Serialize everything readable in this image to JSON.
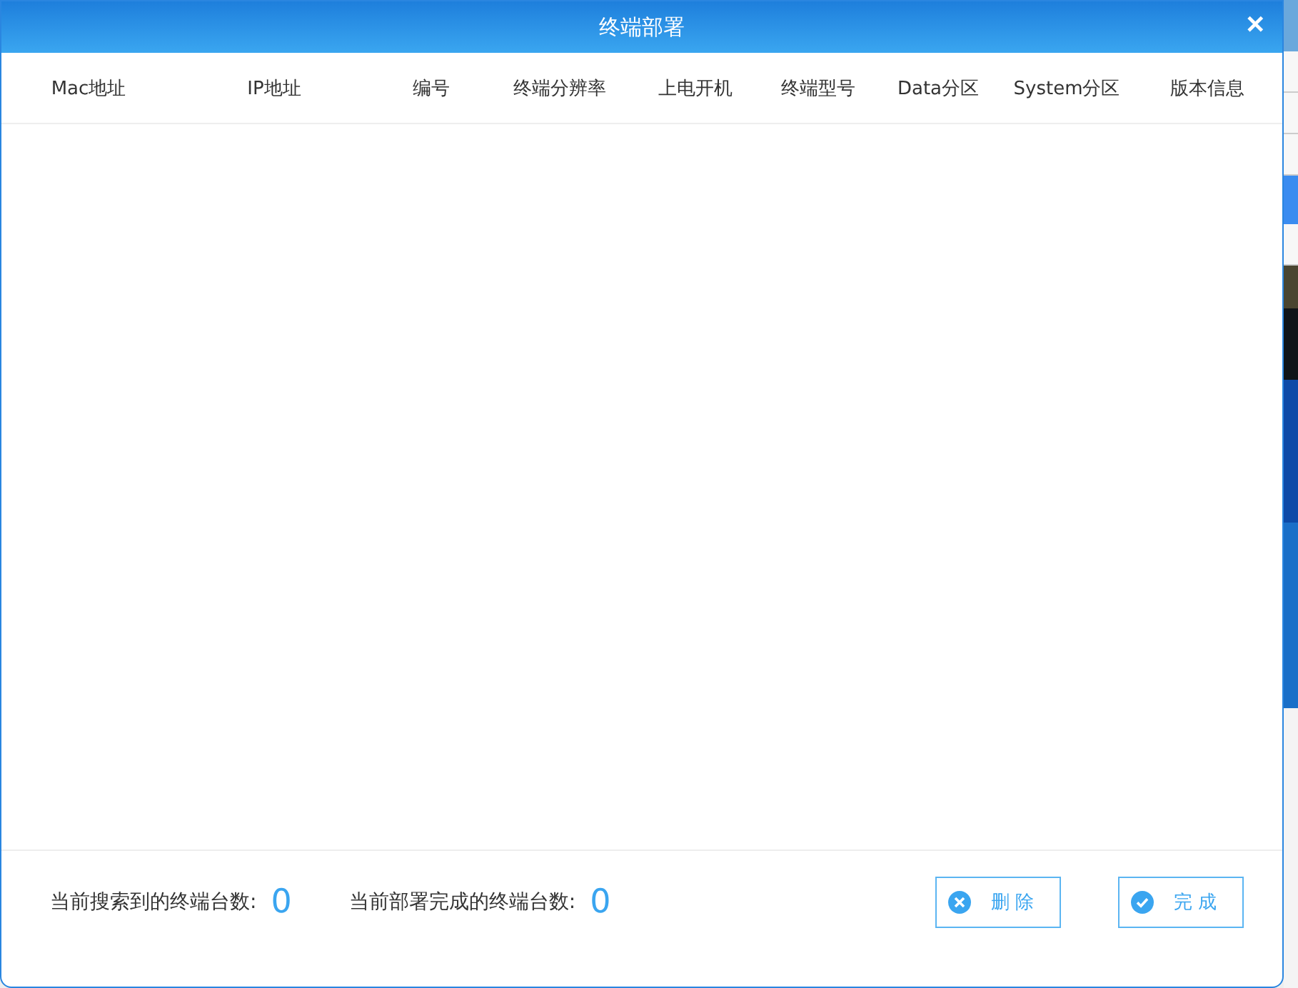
{
  "dialog": {
    "title": "终端部署",
    "close": "✕"
  },
  "table": {
    "columns": [
      "Mac地址",
      "IP地址",
      "编号",
      "终端分辨率",
      "上电开机",
      "终端型号",
      "Data分区",
      "System分区",
      "版本信息"
    ]
  },
  "footer": {
    "stats": [
      {
        "label": "当前搜索到的终端台数:",
        "value": "0"
      },
      {
        "label": "当前部署完成的终端台数:",
        "value": "0"
      }
    ],
    "buttons": [
      {
        "kind": "delete",
        "label": "删 除"
      },
      {
        "kind": "done",
        "label": "完 成"
      }
    ]
  }
}
